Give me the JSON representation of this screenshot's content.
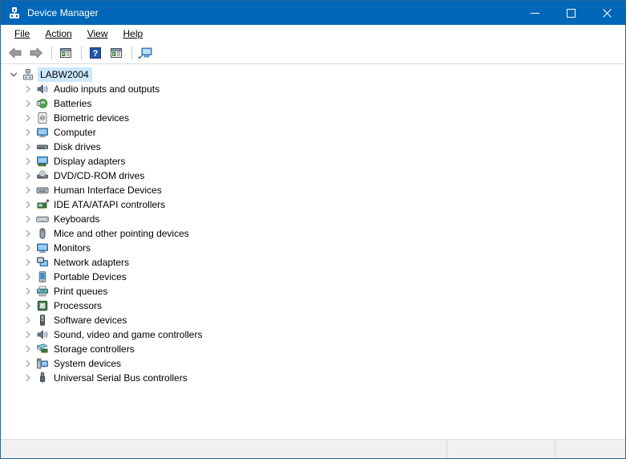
{
  "window": {
    "title": "Device Manager",
    "icon": "device-manager-icon",
    "controls": [
      {
        "name": "minimize-button",
        "glyph": "minimize-icon"
      },
      {
        "name": "maximize-button",
        "glyph": "maximize-icon"
      },
      {
        "name": "close-button",
        "glyph": "close-icon"
      }
    ],
    "titlebar_color": "#0067b8",
    "border_color": "#2a6496"
  },
  "menubar": {
    "items": [
      {
        "label": "File",
        "accel": "F"
      },
      {
        "label": "Action",
        "accel": "A"
      },
      {
        "label": "View",
        "accel": "V"
      },
      {
        "label": "Help",
        "accel": "H"
      }
    ]
  },
  "toolbar": {
    "buttons": [
      {
        "name": "back-button",
        "icon": "arrow-left-icon"
      },
      {
        "name": "forward-button",
        "icon": "arrow-right-icon"
      },
      {
        "name": "separator-1",
        "icon": "separator"
      },
      {
        "name": "show-hide-console-tree-button",
        "icon": "console-tree-icon"
      },
      {
        "name": "separator-2",
        "icon": "separator"
      },
      {
        "name": "help-button",
        "icon": "help-question-icon"
      },
      {
        "name": "properties-button",
        "icon": "properties-icon"
      },
      {
        "name": "separator-3",
        "icon": "separator"
      },
      {
        "name": "scan-for-hardware-changes-button",
        "icon": "scan-hardware-icon"
      }
    ]
  },
  "tree": {
    "root": {
      "label": "LABW2004",
      "icon": "computer-node-icon",
      "expanded": true,
      "selected": true
    },
    "children": [
      {
        "label": "Audio inputs and outputs",
        "icon": "speaker-icon"
      },
      {
        "label": "Batteries",
        "icon": "battery-icon"
      },
      {
        "label": "Biometric devices",
        "icon": "fingerprint-icon"
      },
      {
        "label": "Computer",
        "icon": "monitor-icon"
      },
      {
        "label": "Disk drives",
        "icon": "disk-drive-icon"
      },
      {
        "label": "Display adapters",
        "icon": "display-adapter-icon"
      },
      {
        "label": "DVD/CD-ROM drives",
        "icon": "optical-drive-icon"
      },
      {
        "label": "Human Interface Devices",
        "icon": "hid-icon"
      },
      {
        "label": "IDE ATA/ATAPI controllers",
        "icon": "ide-controller-icon"
      },
      {
        "label": "Keyboards",
        "icon": "keyboard-icon"
      },
      {
        "label": "Mice and other pointing devices",
        "icon": "mouse-icon"
      },
      {
        "label": "Monitors",
        "icon": "monitor-icon"
      },
      {
        "label": "Network adapters",
        "icon": "network-adapter-icon"
      },
      {
        "label": "Portable Devices",
        "icon": "portable-device-icon"
      },
      {
        "label": "Print queues",
        "icon": "printer-icon"
      },
      {
        "label": "Processors",
        "icon": "processor-icon"
      },
      {
        "label": "Software devices",
        "icon": "software-device-icon"
      },
      {
        "label": "Sound, video and game controllers",
        "icon": "speaker-icon"
      },
      {
        "label": "Storage controllers",
        "icon": "storage-controller-icon"
      },
      {
        "label": "System devices",
        "icon": "system-device-icon"
      },
      {
        "label": "Universal Serial Bus controllers",
        "icon": "usb-icon"
      }
    ],
    "collapsed_indicator": "chevron-right-icon",
    "expanded_indicator": "chevron-down-icon",
    "selection_color": "#cde8ff"
  },
  "statusbar": {
    "panes": [
      {
        "text": ""
      },
      {
        "text": ""
      },
      {
        "text": ""
      }
    ]
  }
}
